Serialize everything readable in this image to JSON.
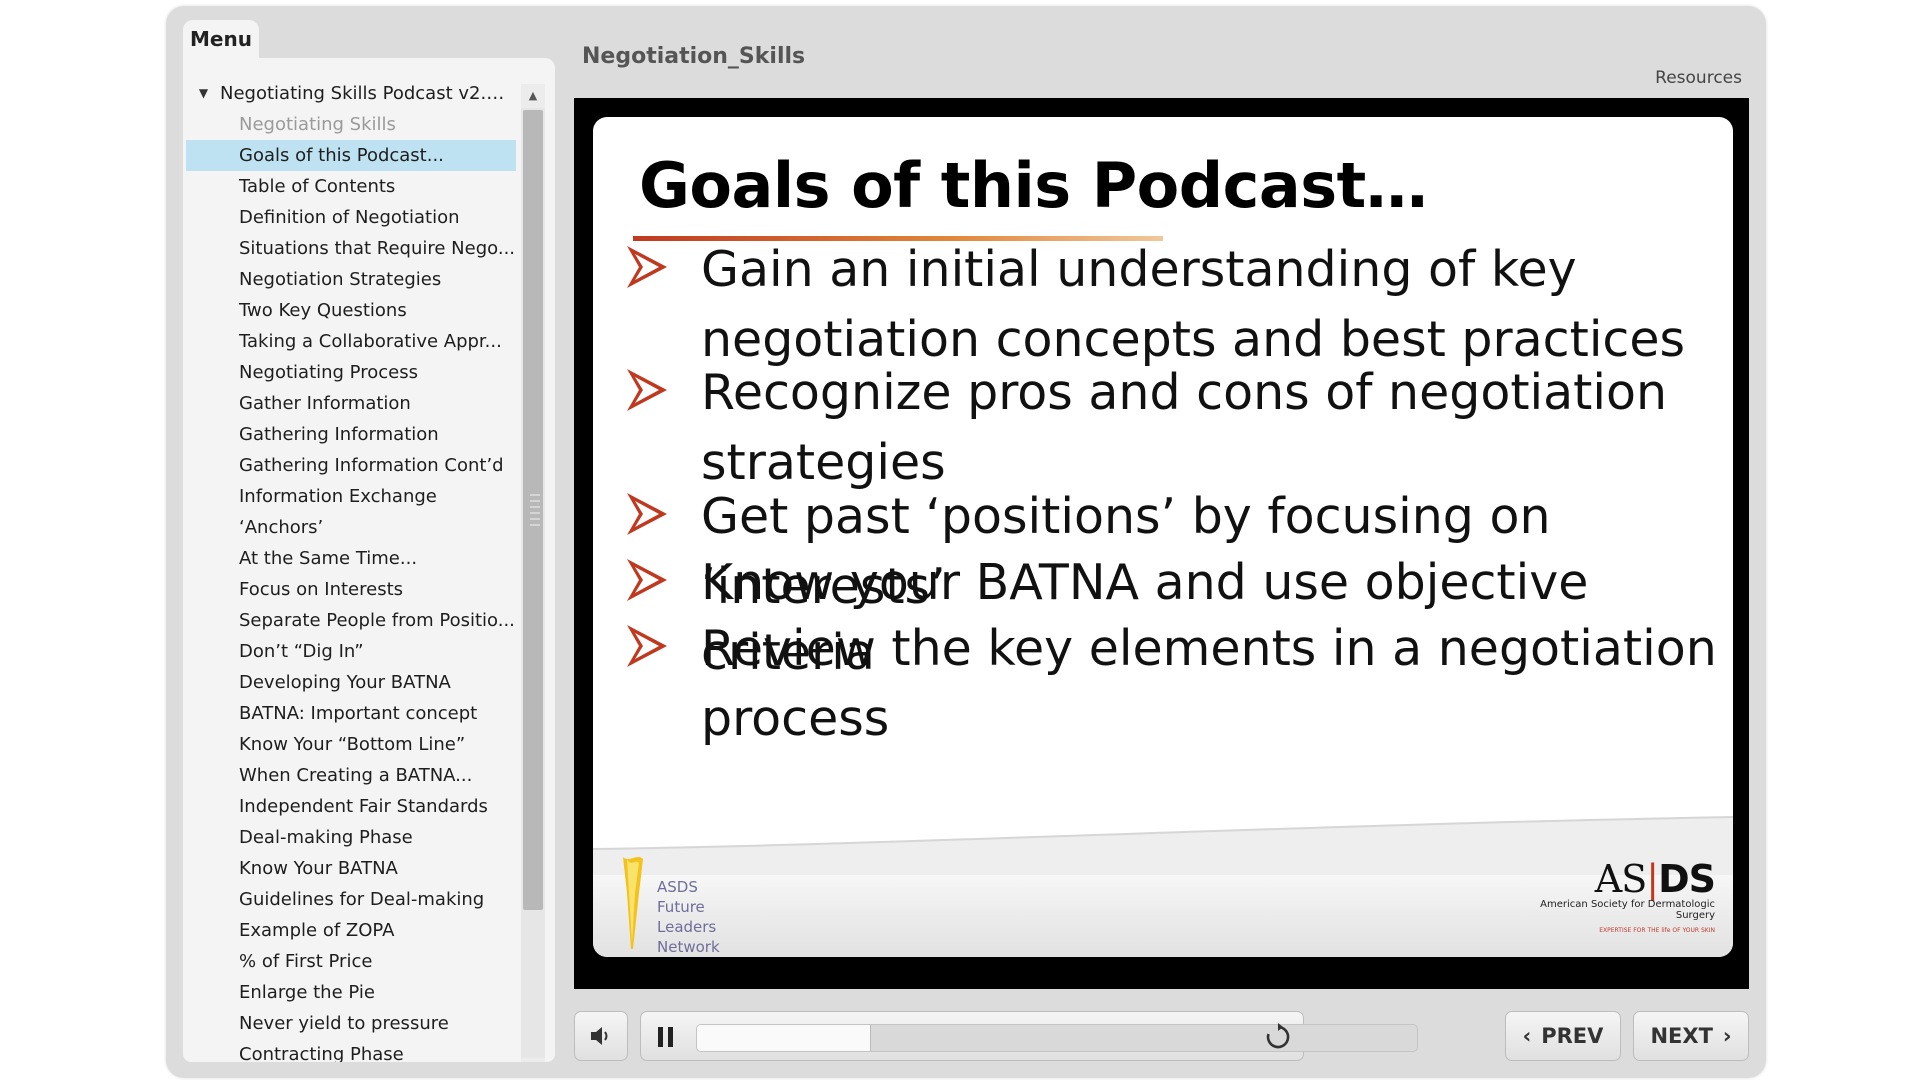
{
  "menu": {
    "tab_label": "Menu",
    "root_label": "Negotiating Skills Podcast v2.re...",
    "items": [
      {
        "label": "Negotiating Skills",
        "state": "dim"
      },
      {
        "label": "Goals of this Podcast...",
        "state": "selected"
      },
      {
        "label": "Table of Contents",
        "state": ""
      },
      {
        "label": "Definition of Negotiation",
        "state": ""
      },
      {
        "label": "Situations that Require Nego...",
        "state": ""
      },
      {
        "label": "Negotiation Strategies",
        "state": ""
      },
      {
        "label": "Two Key Questions",
        "state": ""
      },
      {
        "label": "Taking a Collaborative Appr...",
        "state": ""
      },
      {
        "label": "Negotiating Process",
        "state": ""
      },
      {
        "label": "Gather Information",
        "state": ""
      },
      {
        "label": "Gathering Information",
        "state": ""
      },
      {
        "label": "Gathering Information Cont’d",
        "state": ""
      },
      {
        "label": "Information Exchange",
        "state": ""
      },
      {
        "label": "‘Anchors’",
        "state": ""
      },
      {
        "label": "At the Same Time...",
        "state": ""
      },
      {
        "label": "Focus on Interests",
        "state": ""
      },
      {
        "label": "Separate People from Positio...",
        "state": ""
      },
      {
        "label": "Don’t “Dig In”",
        "state": ""
      },
      {
        "label": "Developing Your BATNA",
        "state": ""
      },
      {
        "label": "BATNA: Important concept",
        "state": ""
      },
      {
        "label": "Know Your “Bottom Line”",
        "state": ""
      },
      {
        "label": "When Creating a BATNA...",
        "state": ""
      },
      {
        "label": "Independent Fair Standards",
        "state": ""
      },
      {
        "label": "Deal-making Phase",
        "state": ""
      },
      {
        "label": "Know Your BATNA",
        "state": ""
      },
      {
        "label": "Guidelines for Deal-making",
        "state": ""
      },
      {
        "label": "Example of ZOPA",
        "state": ""
      },
      {
        "label": "% of First Price",
        "state": ""
      },
      {
        "label": "Enlarge the Pie",
        "state": ""
      },
      {
        "label": "Never yield to pressure",
        "state": ""
      },
      {
        "label": "Contracting Phase",
        "state": ""
      }
    ]
  },
  "header": {
    "title": "Negotiation_Skills",
    "resources_label": "Resources"
  },
  "slide": {
    "title": "Goals of this Podcast…",
    "bullets": [
      "Gain an initial understanding of key negotiation concepts and best practices",
      "Recognize pros and cons of negotiation strategies",
      "Get past ‘positions’ by focusing on ‘interests’",
      "Know your BATNA and use objective criteria",
      "Review the key elements in a negotiation process"
    ],
    "footer_left_lines": [
      "ASDS",
      "Future",
      "Leaders",
      "Network"
    ],
    "footer_right_mark_a": "AS",
    "footer_right_mark_b": "DS",
    "footer_right_sub": "American Society for Dermatologic Surgery",
    "footer_right_tag": "EXPERTISE FOR THE life OF YOUR SKIN",
    "accent_color": "#c0391f"
  },
  "controls": {
    "volume_icon": "speaker-icon",
    "pause_icon": "pause-icon",
    "replay_icon": "replay-icon",
    "progress": 0.24,
    "prev_label": "PREV",
    "next_label": "NEXT"
  }
}
